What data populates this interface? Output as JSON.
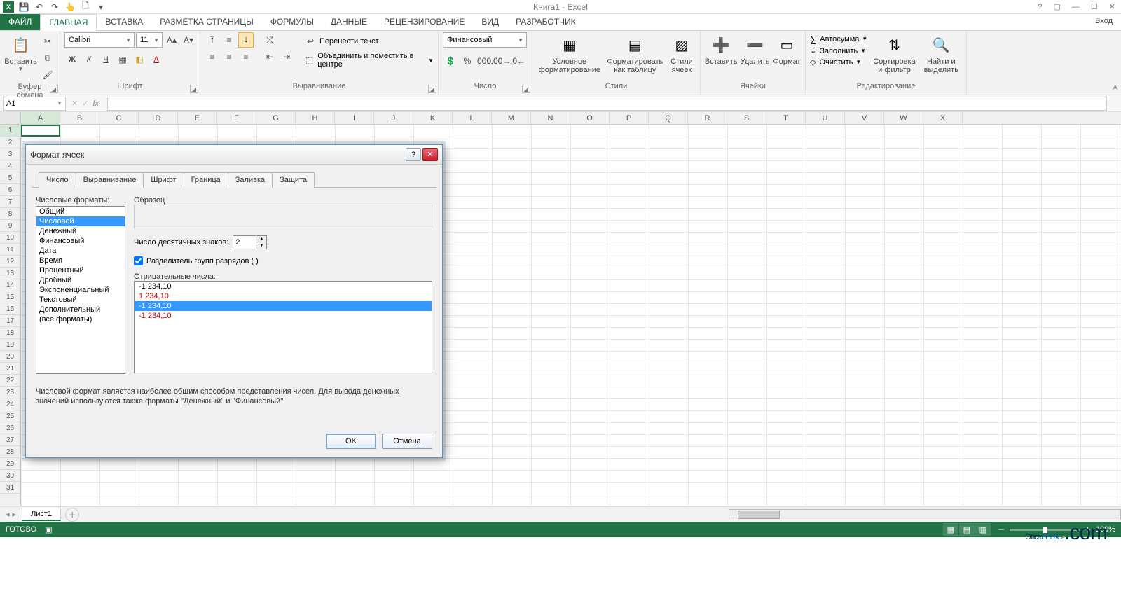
{
  "app": {
    "title": "Книга1 - Excel",
    "login": "Вход"
  },
  "qat": {
    "save": "💾",
    "undo": "↶",
    "redo": "↷",
    "touch": "👆",
    "print": "🗋"
  },
  "tabs": {
    "file": "ФАЙЛ",
    "items": [
      "ГЛАВНАЯ",
      "ВСТАВКА",
      "РАЗМЕТКА СТРАНИЦЫ",
      "ФОРМУЛЫ",
      "ДАННЫЕ",
      "РЕЦЕНЗИРОВАНИЕ",
      "ВИД",
      "РАЗРАБОТЧИК"
    ],
    "active": 0
  },
  "ribbon": {
    "clipboard": {
      "paste": "Вставить",
      "label": "Буфер обмена"
    },
    "font": {
      "name": "Calibri",
      "size": "11",
      "label": "Шрифт"
    },
    "align": {
      "wrap": "Перенести текст",
      "merge": "Объединить и поместить в центре",
      "label": "Выравнивание"
    },
    "number": {
      "format": "Финансовый",
      "label": "Число"
    },
    "styles": {
      "cond": "Условное\nформатирование",
      "table": "Форматировать\nкак таблицу",
      "cell": "Стили\nячеек",
      "label": "Стили"
    },
    "cells": {
      "insert": "Вставить",
      "delete": "Удалить",
      "format": "Формат",
      "label": "Ячейки"
    },
    "editing": {
      "sum": "Автосумма",
      "fill": "Заполнить",
      "clear": "Очистить",
      "sort": "Сортировка\nи фильтр",
      "find": "Найти и\nвыделить",
      "label": "Редактирование"
    }
  },
  "namebox": "A1",
  "cols": [
    "A",
    "B",
    "C",
    "D",
    "E",
    "F",
    "G",
    "H",
    "I",
    "J",
    "K",
    "L",
    "M",
    "N",
    "O",
    "P",
    "Q",
    "R",
    "S",
    "T",
    "U",
    "V",
    "W",
    "X"
  ],
  "rows": [
    1,
    2,
    3,
    4,
    5,
    6,
    7,
    8,
    9,
    10,
    11,
    12,
    13,
    14,
    15,
    16,
    17,
    18,
    19,
    20,
    21,
    22,
    23,
    24,
    25,
    26,
    27,
    28,
    29,
    30,
    31
  ],
  "sheet": {
    "name": "Лист1"
  },
  "status": {
    "ready": "ГОТОВО",
    "zoom": "100%"
  },
  "dialog": {
    "title": "Формат ячеек",
    "tabs": [
      "Число",
      "Выравнивание",
      "Шрифт",
      "Граница",
      "Заливка",
      "Защита"
    ],
    "activeTab": 0,
    "formatsLabel": "Числовые форматы:",
    "formats": [
      "Общий",
      "Числовой",
      "Денежный",
      "Финансовый",
      "Дата",
      "Время",
      "Процентный",
      "Дробный",
      "Экспоненциальный",
      "Текстовый",
      "Дополнительный",
      "(все форматы)"
    ],
    "formatsSel": 1,
    "sampleLabel": "Образец",
    "decimalsLabel": "Число десятичных знаков:",
    "decimals": "2",
    "sepLabel": "Разделитель групп разрядов ( )",
    "sepChecked": true,
    "negLabel": "Отрицательные числа:",
    "negItems": [
      {
        "t": "-1 234,10",
        "cls": ""
      },
      {
        "t": "1 234,10",
        "cls": "red"
      },
      {
        "t": "-1 234,10",
        "cls": "sel"
      },
      {
        "t": "-1 234,10",
        "cls": "red"
      }
    ],
    "desc": "Числовой формат является наиболее общим способом представления чисел. Для вывода денежных значений используются также форматы ''Денежный'' и ''Финансовый''.",
    "ok": "OK",
    "cancel": "Отмена"
  },
  "watermark": {
    "a": "Office",
    "b": "ЛЕГКО",
    "c": ".com"
  }
}
